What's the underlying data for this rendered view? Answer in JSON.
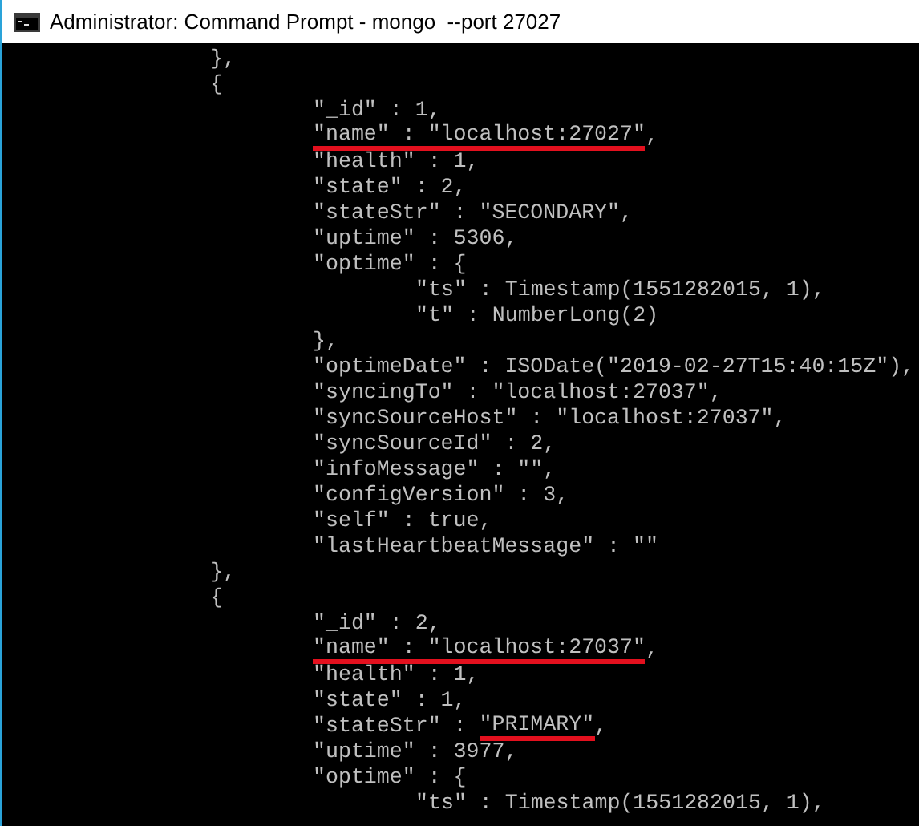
{
  "window": {
    "title": "Administrator: Command Prompt - mongo  --port 27027"
  },
  "console": {
    "lines": [
      {
        "text": "},"
      },
      {
        "open": "{",
        "children": [
          {
            "text": "\"_id\" : 1,"
          },
          {
            "parts": [
              {
                "text": "\"name\" : \"localhost:27027\"",
                "underlined": true
              },
              {
                "text": ",",
                "underlined": false
              }
            ]
          },
          {
            "text": "\"health\" : 1,"
          },
          {
            "text": "\"state\" : 2,"
          },
          {
            "text": "\"stateStr\" : \"SECONDARY\","
          },
          {
            "text": "\"uptime\" : 5306,"
          },
          {
            "open": "\"optime\" : {",
            "children": [
              {
                "text": "\"ts\" : Timestamp(1551282015, 1),"
              },
              {
                "text": "\"t\" : NumberLong(2)"
              }
            ],
            "close": "},"
          },
          {
            "text": "\"optimeDate\" : ISODate(\"2019-02-27T15:40:15Z\"),"
          },
          {
            "text": "\"syncingTo\" : \"localhost:27037\","
          },
          {
            "text": "\"syncSourceHost\" : \"localhost:27037\","
          },
          {
            "text": "\"syncSourceId\" : 2,"
          },
          {
            "text": "\"infoMessage\" : \"\","
          },
          {
            "text": "\"configVersion\" : 3,"
          },
          {
            "text": "\"self\" : true,"
          },
          {
            "text": "\"lastHeartbeatMessage\" : \"\""
          }
        ],
        "close": "},"
      },
      {
        "open": "{",
        "children": [
          {
            "text": "\"_id\" : 2,"
          },
          {
            "parts": [
              {
                "text": "\"name\" : \"localhost:27037\"",
                "underlined": true
              },
              {
                "text": ",",
                "underlined": false
              }
            ]
          },
          {
            "text": "\"health\" : 1,"
          },
          {
            "text": "\"state\" : 1,"
          },
          {
            "parts": [
              {
                "text": "\"stateStr\" : ",
                "underlined": false
              },
              {
                "text": "\"PRIMARY\"",
                "underlined": true
              },
              {
                "text": ",",
                "underlined": false
              }
            ]
          },
          {
            "text": "\"uptime\" : 3977,"
          },
          {
            "open": "\"optime\" : {",
            "children": [
              {
                "text": "\"ts\" : Timestamp(1551282015, 1),"
              }
            ]
          }
        ]
      }
    ]
  }
}
